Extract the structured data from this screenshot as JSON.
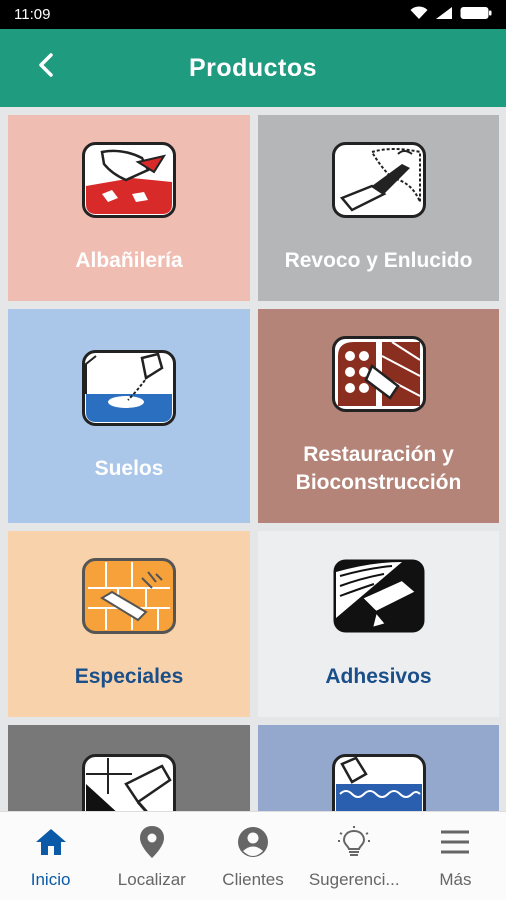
{
  "status": {
    "time": "11:09"
  },
  "header": {
    "title": "Productos",
    "back_icon": "chevron-left-icon"
  },
  "tiles": [
    {
      "label": "Albañilería",
      "bg": "#f0bdb3",
      "label_color": "#ffffff",
      "icon": "masonry-trowel-icon"
    },
    {
      "label": "Revoco y Enlucido",
      "bg": "#b4b6b8",
      "label_color": "#ffffff",
      "icon": "plaster-trowel-icon"
    },
    {
      "label": "Suelos",
      "bg": "#aac6e8",
      "label_color": "#ffffff",
      "icon": "floor-pour-icon"
    },
    {
      "label": "Restauración y\nBioconstrucción",
      "bg": "#b48478",
      "label_color": "#ffffff",
      "icon": "restoration-icon"
    },
    {
      "label": "Especiales",
      "bg": "#f7d2aa",
      "label_color": "#1a4f8a",
      "icon": "special-products-icon"
    },
    {
      "label": "Adhesivos",
      "bg": "#eceeef",
      "label_color": "#1a4f8a",
      "icon": "adhesive-trowel-icon"
    },
    {
      "label": "",
      "bg": "#787878",
      "label_color": "#ffffff",
      "icon": "tile-wall-icon"
    },
    {
      "label": "",
      "bg": "#93a8cc",
      "label_color": "#ffffff",
      "icon": "waterproofing-icon"
    }
  ],
  "nav": [
    {
      "label": "Inicio",
      "icon": "home-icon",
      "active": true
    },
    {
      "label": "Localizar",
      "icon": "location-pin-icon",
      "active": false
    },
    {
      "label": "Clientes",
      "icon": "account-circle-icon",
      "active": false
    },
    {
      "label": "Sugerenci...",
      "icon": "lightbulb-icon",
      "active": false
    },
    {
      "label": "Más",
      "icon": "menu-icon",
      "active": false
    }
  ]
}
